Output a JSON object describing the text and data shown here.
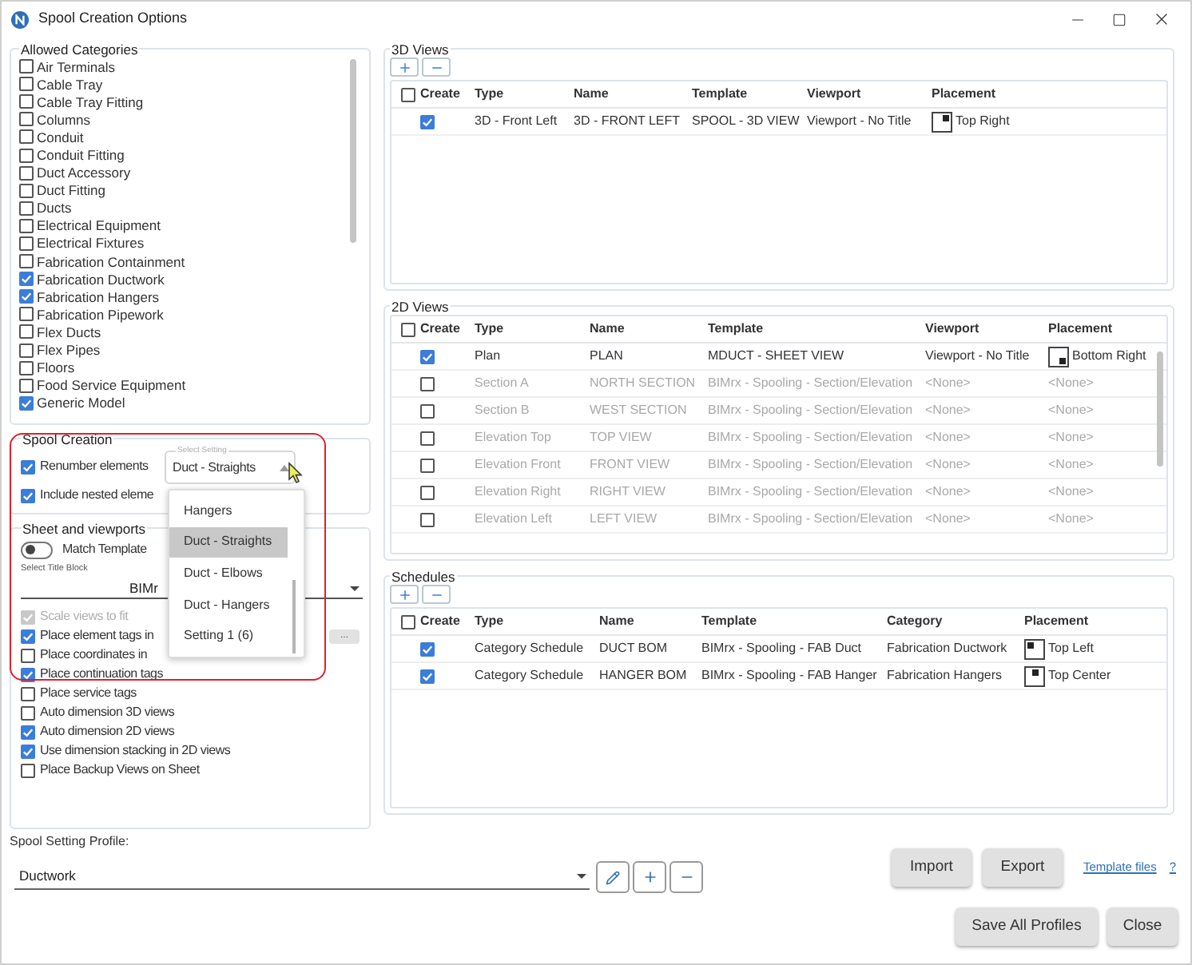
{
  "window": {
    "title": "Spool Creation Options"
  },
  "allowed_categories": {
    "legend": "Allowed Categories",
    "items": [
      {
        "label": "Air Terminals",
        "checked": false
      },
      {
        "label": "Cable Tray",
        "checked": false
      },
      {
        "label": "Cable Tray Fitting",
        "checked": false
      },
      {
        "label": "Columns",
        "checked": false
      },
      {
        "label": "Conduit",
        "checked": false
      },
      {
        "label": "Conduit Fitting",
        "checked": false
      },
      {
        "label": "Duct Accessory",
        "checked": false
      },
      {
        "label": "Duct Fitting",
        "checked": false
      },
      {
        "label": "Ducts",
        "checked": false
      },
      {
        "label": "Electrical Equipment",
        "checked": false
      },
      {
        "label": "Electrical Fixtures",
        "checked": false
      },
      {
        "label": "Fabrication Containment",
        "checked": false
      },
      {
        "label": "Fabrication Ductwork",
        "checked": true
      },
      {
        "label": "Fabrication Hangers",
        "checked": true
      },
      {
        "label": "Fabrication Pipework",
        "checked": false
      },
      {
        "label": "Flex Ducts",
        "checked": false
      },
      {
        "label": "Flex Pipes",
        "checked": false
      },
      {
        "label": "Floors",
        "checked": false
      },
      {
        "label": "Food Service Equipment",
        "checked": false
      },
      {
        "label": "Generic Model",
        "checked": true
      }
    ]
  },
  "spool_creation": {
    "legend": "Spool Creation",
    "options": [
      {
        "label": "Renumber elements",
        "checked": true
      },
      {
        "label": "Include nested eleme",
        "checked": true
      }
    ],
    "setting_select": {
      "label": "Select Setting",
      "value": "Duct - Straights",
      "expanded": true,
      "options": [
        {
          "label": "Hangers",
          "selected": false
        },
        {
          "label": "Duct - Straights",
          "selected": true
        },
        {
          "label": "Duct - Elbows",
          "selected": false
        },
        {
          "label": "Duct - Hangers",
          "selected": false
        },
        {
          "label": "Setting 1 (6)",
          "selected": false
        }
      ]
    }
  },
  "sheet_and_viewports": {
    "legend": "Sheet and viewports",
    "match_template": {
      "label": "Match Template",
      "on": false
    },
    "title_block": {
      "label": "Select Title Block",
      "value": "BIMr"
    },
    "more_button": "...",
    "options": [
      {
        "label": "Scale views to fit",
        "checked": true,
        "disabled": true
      },
      {
        "label": "Place element tags in",
        "checked": true,
        "disabled": false
      },
      {
        "label": "Place coordinates in",
        "checked": false,
        "disabled": false
      },
      {
        "label": "Place continuation tags",
        "checked": true,
        "disabled": false
      },
      {
        "label": "Place service tags",
        "checked": false,
        "disabled": false
      },
      {
        "label": "Auto dimension 3D views",
        "checked": false,
        "disabled": false
      },
      {
        "label": "Auto dimension 2D views",
        "checked": true,
        "disabled": false
      },
      {
        "label": "Use dimension stacking in 2D views",
        "checked": true,
        "disabled": false
      },
      {
        "label": "Place Backup Views on Sheet",
        "checked": false,
        "disabled": false
      }
    ]
  },
  "tables": [
    {
      "legend": "3D Views",
      "add_remove": true,
      "all_checked": false,
      "create_column": "Create",
      "columns": [
        "Type",
        "Name",
        "Template",
        "Viewport",
        "Placement"
      ],
      "rows": [
        {
          "create": true,
          "disabled": false,
          "cells": [
            "3D - Front Left",
            "3D - FRONT LEFT",
            "SPOOL - 3D VIEW",
            "Viewport - No Title",
            "Top Right"
          ],
          "kind": "topright"
        }
      ]
    },
    {
      "legend": "2D Views",
      "add_remove": false,
      "all_checked": false,
      "create_column": "Create",
      "columns": [
        "Type",
        "Name",
        "Template",
        "Viewport",
        "Placement"
      ],
      "rows": [
        {
          "create": true,
          "disabled": false,
          "cells": [
            "Plan",
            "PLAN",
            "MDUCT - SHEET VIEW",
            "Viewport - No Title",
            "Bottom Right"
          ],
          "kind": "bottomright"
        },
        {
          "create": false,
          "disabled": true,
          "cells": [
            "Section A",
            "NORTH SECTION",
            "BIMrx - Spooling - Section/Elevation",
            "<None>",
            "<None>"
          ]
        },
        {
          "create": false,
          "disabled": true,
          "cells": [
            "Section B",
            "WEST SECTION",
            "BIMrx - Spooling - Section/Elevation",
            "<None>",
            "<None>"
          ]
        },
        {
          "create": false,
          "disabled": true,
          "cells": [
            "Elevation Top",
            "TOP VIEW",
            "BIMrx - Spooling - Section/Elevation",
            "<None>",
            "<None>"
          ]
        },
        {
          "create": false,
          "disabled": true,
          "cells": [
            "Elevation Front",
            "FRONT VIEW",
            "BIMrx - Spooling - Section/Elevation",
            "<None>",
            "<None>"
          ]
        },
        {
          "create": false,
          "disabled": true,
          "cells": [
            "Elevation Right",
            "RIGHT VIEW",
            "BIMrx - Spooling - Section/Elevation",
            "<None>",
            "<None>"
          ]
        },
        {
          "create": false,
          "disabled": true,
          "cells": [
            "Elevation Left",
            "LEFT VIEW",
            "BIMrx - Spooling - Section/Elevation",
            "<None>",
            "<None>"
          ]
        }
      ]
    },
    {
      "legend": "Schedules",
      "add_remove": true,
      "all_checked": false,
      "create_column": "Create",
      "columns": [
        "Type",
        "Name",
        "Template",
        "Category",
        "Placement"
      ],
      "rows": [
        {
          "create": true,
          "disabled": false,
          "cells": [
            "Category Schedule",
            "DUCT BOM",
            "BIMrx - Spooling - FAB Duct",
            "Fabrication Ductwork",
            "Top Left"
          ],
          "kind": "topleft"
        },
        {
          "create": true,
          "disabled": false,
          "cells": [
            "Category Schedule",
            "HANGER BOM",
            "BIMrx - Spooling - FAB Hanger",
            "Fabrication Hangers",
            "Top Center"
          ],
          "kind": "topcenter"
        }
      ]
    }
  ],
  "profile": {
    "label": "Spool Setting Profile:",
    "value": "Ductwork"
  },
  "actions": {
    "import": "Import",
    "export": "Export",
    "template_link": "Template files",
    "help": "?"
  },
  "footer": {
    "save": "Save All Profiles",
    "close": "Close"
  }
}
